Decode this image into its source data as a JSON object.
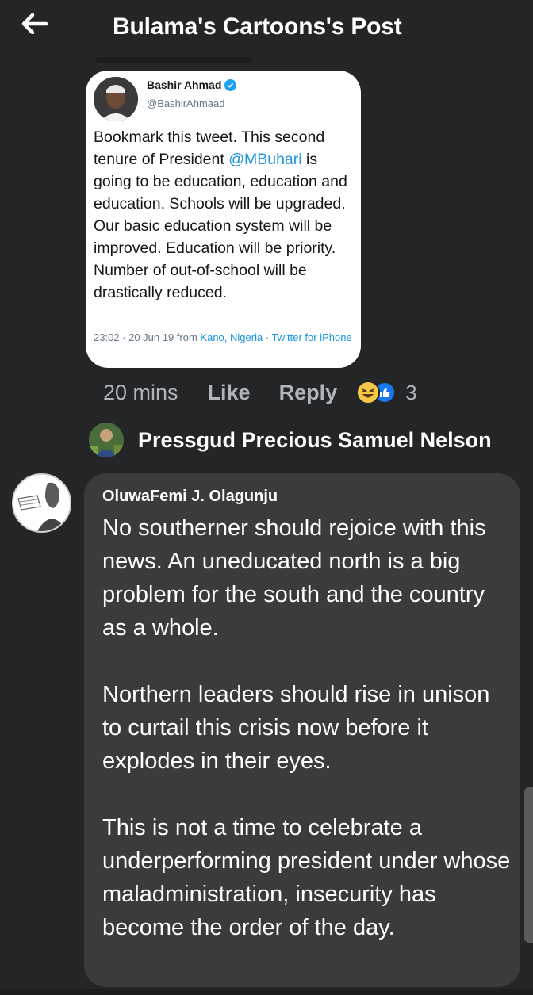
{
  "header": {
    "title": "Bulama's Cartoons's Post",
    "back_icon": "arrow-left-icon"
  },
  "tweet": {
    "author_name": "Bashir Ahmad",
    "verified_icon": "verified-badge-icon",
    "handle": "@BashirAhmaad",
    "text_before_mention": "Bookmark this tweet. This second tenure of President ",
    "mention": "@MBuhari",
    "text_after_mention": " is going to be education, education and education. Schools will be upgraded. Our basic education system will be improved. Education will be priority. Number of out-of-school will be drastically reduced.",
    "timestamp": "23:02 · 20 Jun 19 from ",
    "location": "Kano, Nigeria",
    "separator": " · ",
    "source": "Twitter for iPhone",
    "accent_color": "#1b95e0"
  },
  "post_actions": {
    "time": "20 mins",
    "like_label": "Like",
    "reply_label": "Reply",
    "reaction_icons": [
      "haha-reaction-icon",
      "like-reaction-icon"
    ],
    "reaction_count": "3"
  },
  "reply_author": {
    "name": "Pressgud Precious Samuel Nelson"
  },
  "comment": {
    "author": "OluwaFemi J. Olagunju",
    "paragraphs": [
      "No southerner should rejoice with this news. An uneducated north is a big problem for the south and the country as a whole.",
      "Northern leaders should rise in unison to curtail this crisis now before it explodes in their eyes.",
      "This is not a time to celebrate a underperforming president under whose maladministration, insecurity has become the order of the day."
    ]
  },
  "colors": {
    "background": "#242526",
    "bubble": "#3a3b3c",
    "secondary_text": "#b0b3b8",
    "like_blue": "#1877f2",
    "haha_yellow": "#f7c948"
  }
}
